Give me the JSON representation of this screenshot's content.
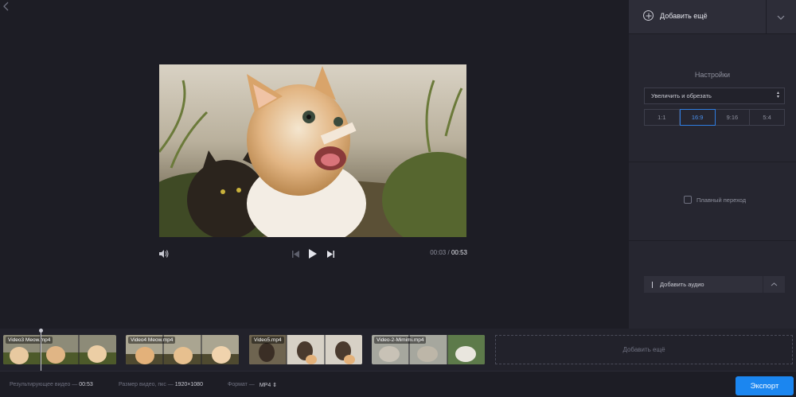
{
  "back_icon": "chevron-left-icon",
  "player": {
    "current_time": "00:03",
    "separator": "/",
    "duration": "00:53"
  },
  "panel": {
    "add_more_label": "Добавить ещё",
    "settings_title": "Настройки",
    "resize_mode": "Увеличить и обрезать",
    "ratios": [
      "1:1",
      "16:9",
      "9:16",
      "5:4"
    ],
    "active_ratio": "16:9",
    "transition_label": "Плавный переход",
    "add_audio_label": "Добавить аудио"
  },
  "timeline": {
    "clips": [
      {
        "label": "Video3 Meow.mp4"
      },
      {
        "label": "Video4 Meow.mp4"
      },
      {
        "label": "Video5.mp4"
      },
      {
        "label": "Video-2-Mimimi.mp4"
      }
    ],
    "add_more_label": "Добавить ещё"
  },
  "bottom": {
    "result_label": "Результирующее видео —",
    "result_value": "00:53",
    "size_label": "Размер видео, пкс —",
    "size_value": "1920×1080",
    "format_label": "Формат —",
    "format_value": "MP4",
    "export_label": "Экспорт"
  },
  "colors": {
    "accent": "#1b86f0",
    "background": "#1d1d25",
    "panel": "#262630"
  }
}
